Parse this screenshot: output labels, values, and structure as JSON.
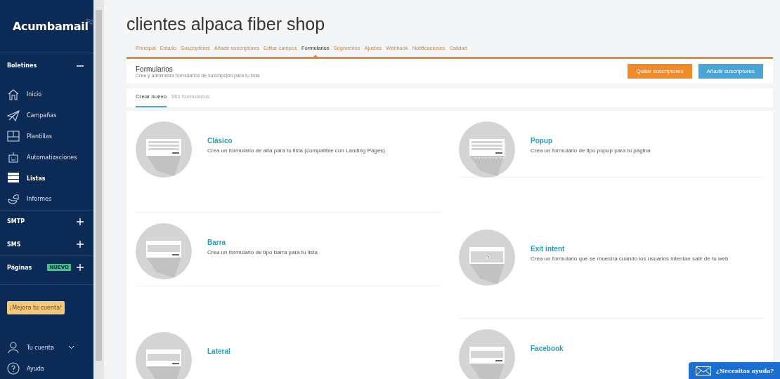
{
  "sidebar": {
    "logo": "Acumbamail",
    "sections": [
      {
        "label": "Boletines",
        "expanded": true,
        "items": [
          {
            "label": "Inicio",
            "selected": false
          },
          {
            "label": "Campañas",
            "selected": false
          },
          {
            "label": "Plantillas",
            "selected": false
          },
          {
            "label": "Automatizaciones",
            "selected": false
          },
          {
            "label": "Listas",
            "selected": true
          },
          {
            "label": "Informes",
            "selected": false
          }
        ]
      },
      {
        "label": "SMTP",
        "expanded": false
      },
      {
        "label": "SMS",
        "expanded": false
      },
      {
        "label": "Páginas",
        "expanded": false,
        "badge": "NUEVO"
      }
    ],
    "upgrade_button": "¡Mejora tu cuenta!",
    "account": "Tu cuenta",
    "help": "Ayuda"
  },
  "title": "clientes alpaca fiber shop",
  "tabs": [
    {
      "label": "Principal",
      "selected": false
    },
    {
      "label": "Estado",
      "selected": false
    },
    {
      "label": "Suscriptores",
      "selected": false
    },
    {
      "label": "Añadir suscriptores",
      "selected": false
    },
    {
      "label": "Editar campos",
      "selected": false
    },
    {
      "label": "Formularios",
      "selected": true
    },
    {
      "label": "Segmentos",
      "selected": false
    },
    {
      "label": "Ajustes",
      "selected": false
    },
    {
      "label": "Webhook",
      "selected": false
    },
    {
      "label": "Notificaciones",
      "selected": false
    },
    {
      "label": "Calidad",
      "selected": false
    }
  ],
  "header": {
    "title": "Formularios",
    "subtitle": "Crea y administra formularios de suscripción para tu lista",
    "buttons": [
      {
        "label": "Quitar suscriptores",
        "kind": "warning"
      },
      {
        "label": "Añadir suscriptores",
        "kind": "primary"
      }
    ]
  },
  "subtabs": [
    {
      "label": "Crear nuevo",
      "selected": true
    },
    {
      "label": "Mis formularios",
      "selected": false
    }
  ],
  "columns": [
    [
      {
        "title": "Clásico",
        "description": "Crea un formulario de alta para tu lista (compatible con Landing Pages)",
        "kind": "classic"
      },
      {
        "title": "Barra",
        "description": "Crea un formulario de tipo barra para tu lista",
        "kind": "bar"
      },
      {
        "title": "Lateral",
        "kind": "bar"
      }
    ],
    [
      {
        "title": "Popup",
        "description": "Crea un formulario de tipo popup para tu página",
        "kind": "popup"
      },
      {
        "title": "Exit intent",
        "description": "Crea un formulario que se muestra cuando los usuarios intentan salir de tu web",
        "kind": "exit"
      },
      {
        "title": "Facebook",
        "kind": "bar"
      }
    ]
  ],
  "help_widget": "¿Necesitas ayuda?"
}
